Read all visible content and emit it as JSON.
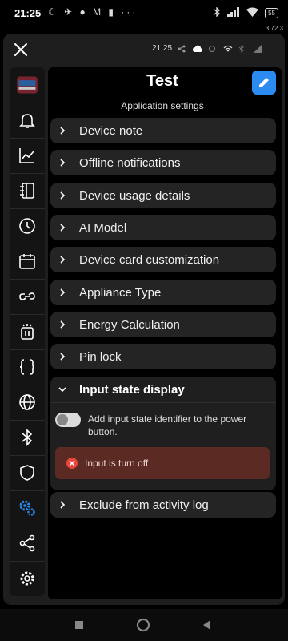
{
  "status_bar": {
    "time": "21:25",
    "left_icons": "☾ ✈ ● M ▮ ···",
    "battery": "55",
    "version": "3.72.3"
  },
  "window": {
    "bar_time": "21:25"
  },
  "sidebar": {
    "items": [
      {
        "icon": "device-thumbnail-icon"
      },
      {
        "icon": "bell-icon"
      },
      {
        "icon": "chart-line-icon"
      },
      {
        "icon": "notebook-icon"
      },
      {
        "icon": "clock-icon"
      },
      {
        "icon": "calendar-icon"
      },
      {
        "icon": "link-icon"
      },
      {
        "icon": "scene-icon"
      },
      {
        "icon": "code-braces-icon"
      },
      {
        "icon": "globe-icon"
      },
      {
        "icon": "bluetooth-icon"
      },
      {
        "icon": "shield-icon"
      },
      {
        "icon": "gears-icon",
        "active": true
      },
      {
        "icon": "share-icon"
      },
      {
        "icon": "settings-icon"
      }
    ]
  },
  "page": {
    "title": "Test",
    "subtitle": "Application settings"
  },
  "sections": [
    {
      "label": "Device note"
    },
    {
      "label": "Offline notifications"
    },
    {
      "label": "Device usage details"
    },
    {
      "label": "AI Model"
    },
    {
      "label": "Device card customization"
    },
    {
      "label": "Appliance Type"
    },
    {
      "label": "Energy Calculation"
    },
    {
      "label": "Pin lock"
    }
  ],
  "expanded_section": {
    "label": "Input state display",
    "toggle_label": "Add input state identifier to the power button.",
    "toggle_on": false,
    "alert_text": "Input is turn off"
  },
  "last_section": {
    "label": "Exclude from activity log"
  },
  "colors": {
    "accent": "#2b8bf0",
    "alert_bg": "#5b2a23",
    "alert_icon": "#e8453c"
  }
}
